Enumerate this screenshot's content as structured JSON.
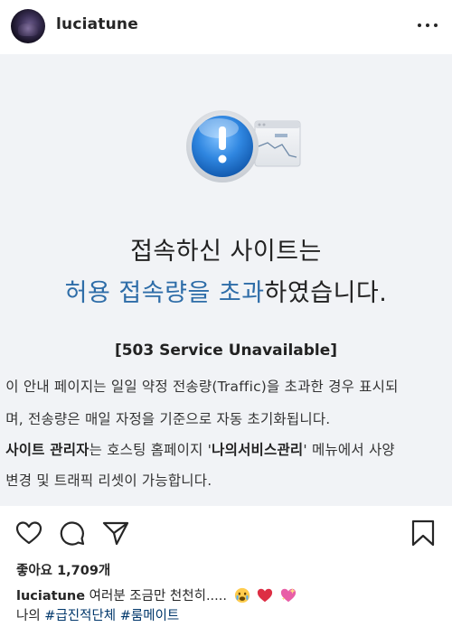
{
  "header": {
    "username": "luciatune"
  },
  "post": {
    "heading_line1": "접속하신 사이트는",
    "heading_line2_blue": "허용 접속량을 초과",
    "heading_line2_rest": "하였습니다.",
    "error_title": "[503 Service Unavailable]",
    "para1": "이 안내 페이지는 일일 약정 전송량(Traffic)을 초과한 경우 표시되",
    "para2": "며, 전송량은 매일 자정을 기준으로 자동 초기화됩니다.",
    "para3_bold": "사이트 관리자",
    "para3_mid": "는 호스팅 홈페이지 '",
    "para3_bold2": "나의서비스관리",
    "para3_end": "' 메뉴에서 사양",
    "para4": "변경 및 트래픽 리셋이 가능합니다."
  },
  "engagement": {
    "likes": "좋아요 1,709개"
  },
  "caption": {
    "username": "luciatune",
    "text": " 여러분 조금만 천천히.....",
    "tag_prefix": "나의 ",
    "tag1": "#급진적단체",
    "tag2": "#룸메이트"
  },
  "colors": {
    "accent_blue": "#2e6da8",
    "hashtag": "#00376b",
    "post_bg": "#f1f3f6"
  },
  "icons": [
    "more-icon",
    "alert-icon",
    "heart-icon",
    "comment-icon",
    "share-icon",
    "bookmark-icon",
    "crying-emoji",
    "red-heart-emoji",
    "sparkling-heart-emoji"
  ]
}
